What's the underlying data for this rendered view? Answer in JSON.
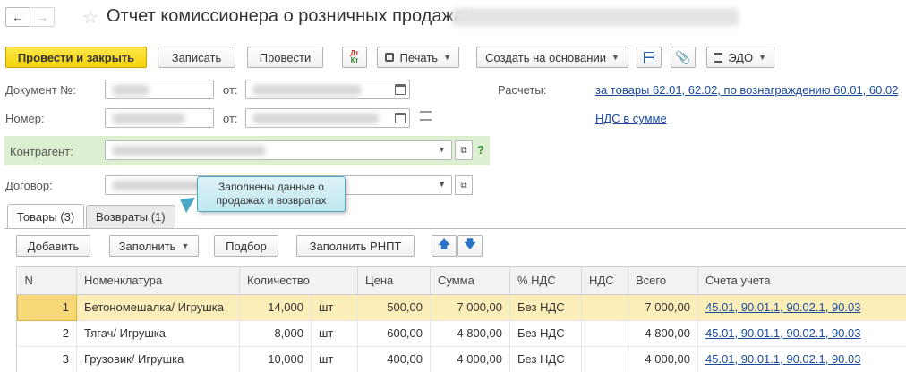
{
  "window": {
    "title": "Отчет комиссионера о розничных продажах"
  },
  "toolbar": {
    "post_and_close": "Провести и закрыть",
    "save": "Записать",
    "post": "Провести",
    "dt_kt_label": "Дт\nКт",
    "print": "Печать",
    "create_based_on": "Создать на основании",
    "edo": "ЭДО"
  },
  "form": {
    "doc_number_label": "Документ №:",
    "number_label": "Номер:",
    "from_label": "от:",
    "from_label2": "от:",
    "settlements_label": "Расчеты:",
    "settlements_link": "за товары 62.01, 62.02, по вознаграждению 60.01, 60.02",
    "vat_link": "НДС в сумме",
    "counterparty_label": "Контрагент:",
    "contract_label": "Договор:",
    "help": "?"
  },
  "tooltip": {
    "text": "Заполнены данные о продажах и возвратах"
  },
  "tabs": [
    {
      "label": "Товары (3)",
      "active": true
    },
    {
      "label": "Возвраты (1)",
      "active": false
    }
  ],
  "table_toolbar": {
    "add": "Добавить",
    "fill": "Заполнить",
    "selection": "Подбор",
    "fill_rnpt": "Заполнить РНПТ"
  },
  "table": {
    "columns": [
      "N",
      "Номенклатура",
      "Количество",
      "Цена",
      "Сумма",
      "% НДС",
      "НДС",
      "Всего",
      "Счета учета"
    ],
    "rows": [
      {
        "n": "1",
        "item": "Бетономешалка/ Игрушка",
        "qty": "14,000",
        "unit": "шт",
        "price": "500,00",
        "sum": "7 000,00",
        "vat_rate": "Без НДС",
        "vat": "",
        "total": "7 000,00",
        "accounts": "45.01, 90.01.1, 90.02.1, 90.03"
      },
      {
        "n": "2",
        "item": "Тягач/ Игрушка",
        "qty": "8,000",
        "unit": "шт",
        "price": "600,00",
        "sum": "4 800,00",
        "vat_rate": "Без НДС",
        "vat": "",
        "total": "4 800,00",
        "accounts": "45.01, 90.01.1, 90.02.1, 90.03"
      },
      {
        "n": "3",
        "item": "Грузовик/ Игрушка",
        "qty": "10,000",
        "unit": "шт",
        "price": "400,00",
        "sum": "4 000,00",
        "vat_rate": "Без НДС",
        "vat": "",
        "total": "4 000,00",
        "accounts": "45.01, 90.01.1, 90.02.1, 90.03"
      }
    ]
  },
  "colors": {
    "primary_button": "#f5d10b",
    "link": "#1a4a9c",
    "selected_row": "#fbeeb8",
    "counterparty_highlight": "#dcefd0",
    "tooltip": "#bfe7f0"
  }
}
